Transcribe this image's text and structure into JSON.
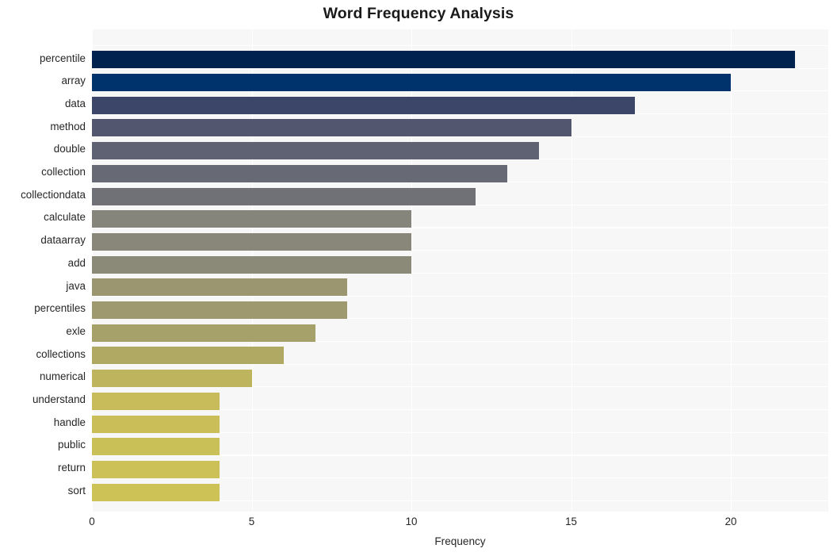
{
  "chart_data": {
    "type": "bar",
    "orientation": "horizontal",
    "title": "Word Frequency Analysis",
    "xlabel": "Frequency",
    "ylabel": "",
    "xlim": [
      0,
      23.05
    ],
    "xticks": [
      0,
      5,
      10,
      15,
      20
    ],
    "xtick_labels": [
      "0",
      "5",
      "10",
      "15",
      "20"
    ],
    "grid": true,
    "grid_color": "#ffffff",
    "plot_background": "#f7f7f7",
    "figure_background": "#ffffff",
    "legend": null,
    "categories": [
      "percentile",
      "array",
      "data",
      "method",
      "double",
      "collection",
      "collectiondata",
      "calculate",
      "dataarray",
      "add",
      "java",
      "percentiles",
      "exle",
      "collections",
      "numerical",
      "understand",
      "handle",
      "public",
      "return",
      "sort"
    ],
    "values": [
      22,
      20,
      17,
      15,
      14,
      13,
      12,
      10,
      10,
      10,
      8,
      8,
      7,
      6,
      5,
      4,
      4,
      4,
      4,
      4
    ],
    "bar_colors": [
      "#00224e",
      "#00336b",
      "#3b4668",
      "#52576f",
      "#5e6273",
      "#676a74",
      "#6f7177",
      "#85857b",
      "#888779",
      "#8b8a78",
      "#9b9670",
      "#9e996e",
      "#a6a06a",
      "#b0a964",
      "#bdb45d",
      "#c7bc59",
      "#c9be58",
      "#cac058",
      "#ccc157",
      "#cdc256"
    ]
  }
}
